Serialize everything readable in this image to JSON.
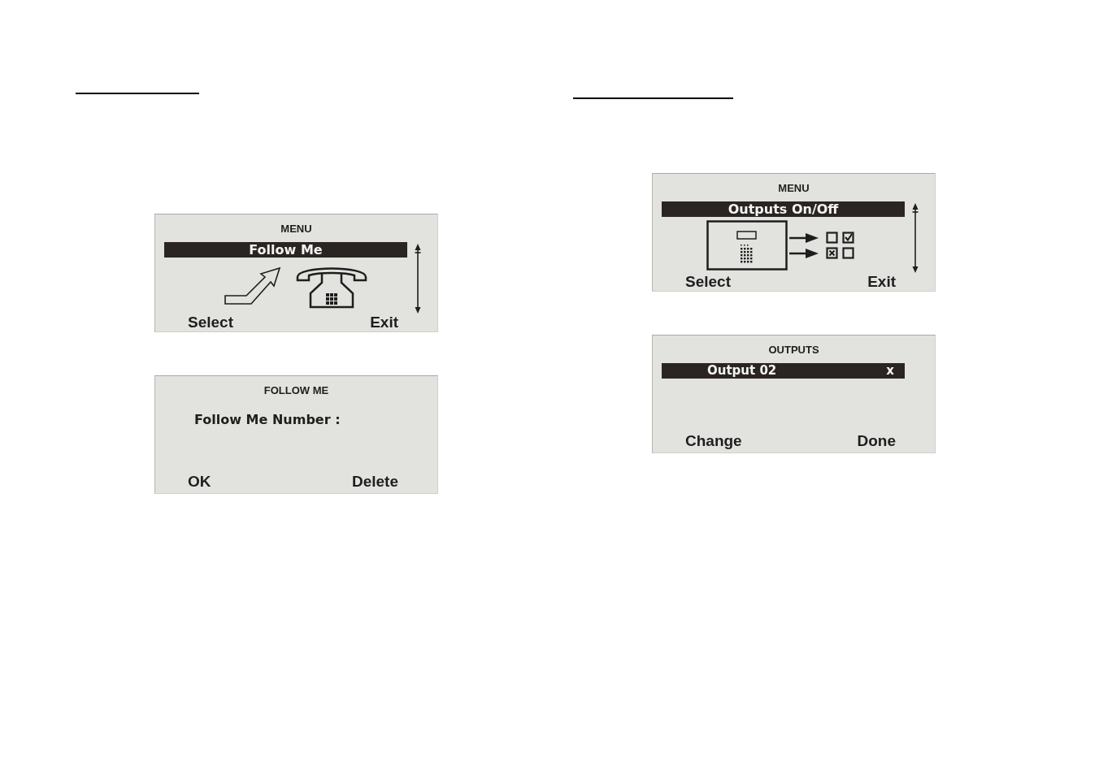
{
  "sections": [
    {
      "screens": [
        {
          "kind": "menu",
          "title": "MENU",
          "item": {
            "label": "Follow Me",
            "selected": true
          },
          "illustration": {
            "kind": "telephone"
          },
          "softkeys": [
            "Select",
            "Exit"
          ]
        },
        {
          "kind": "entry",
          "title": "FOLLOW ME",
          "prompt": "Follow Me Number :",
          "softkeys": [
            "OK",
            "Delete"
          ]
        }
      ]
    },
    {
      "screens": [
        {
          "kind": "menu",
          "title": "MENU",
          "item": {
            "label": "Outputs On/Off",
            "selected": true
          },
          "illustration": {
            "kind": "keypad"
          },
          "softkeys": [
            "Select",
            "Exit"
          ]
        },
        {
          "kind": "list",
          "title": "OUTPUTS",
          "item": {
            "label": "Output 02",
            "value": "x",
            "selected": true
          },
          "softkeys": [
            "Change",
            "Done"
          ]
        }
      ]
    }
  ]
}
